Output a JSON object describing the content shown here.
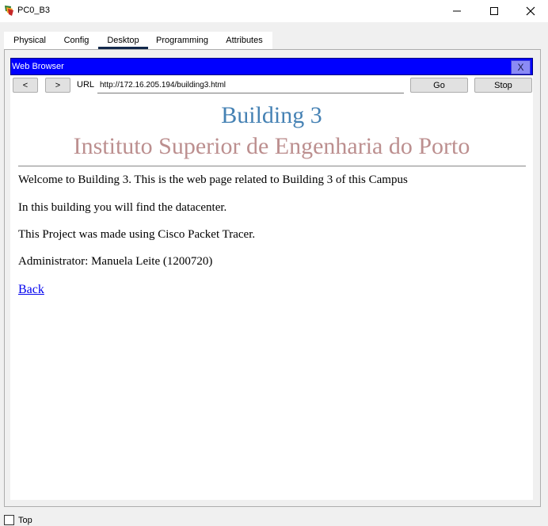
{
  "window": {
    "title": "PC0_B3",
    "icon": "packet-tracer-pc-icon",
    "controls": [
      "minimize-icon",
      "maximize-icon",
      "close-icon"
    ]
  },
  "tabs": [
    {
      "label": "Physical",
      "active": false
    },
    {
      "label": "Config",
      "active": false
    },
    {
      "label": "Desktop",
      "active": true
    },
    {
      "label": "Programming",
      "active": false
    },
    {
      "label": "Attributes",
      "active": false
    }
  ],
  "browser": {
    "title": "Web Browser",
    "close_label": "X",
    "back_label": "<",
    "forward_label": ">",
    "url_label": "URL",
    "url_value": "http://172.16.205.194/building3.html",
    "go_label": "Go",
    "stop_label": "Stop",
    "header_color": "#0000ff"
  },
  "page": {
    "heading": "Building 3",
    "subheading": "Instituto Superior de Engenharia do Porto",
    "heading_color": "#4682b4",
    "subheading_color": "#bc8f8f",
    "paragraphs": [
      "Welcome to Building 3. This is the web page related to Building 3 of this Campus",
      "In this building you will find the datacenter.",
      "This Project was made using Cisco Packet Tracer.",
      "Administrator: Manuela Leite (1200720)"
    ],
    "link_label": "Back"
  },
  "footer": {
    "checkbox_label": "Top",
    "checkbox_checked": false
  }
}
